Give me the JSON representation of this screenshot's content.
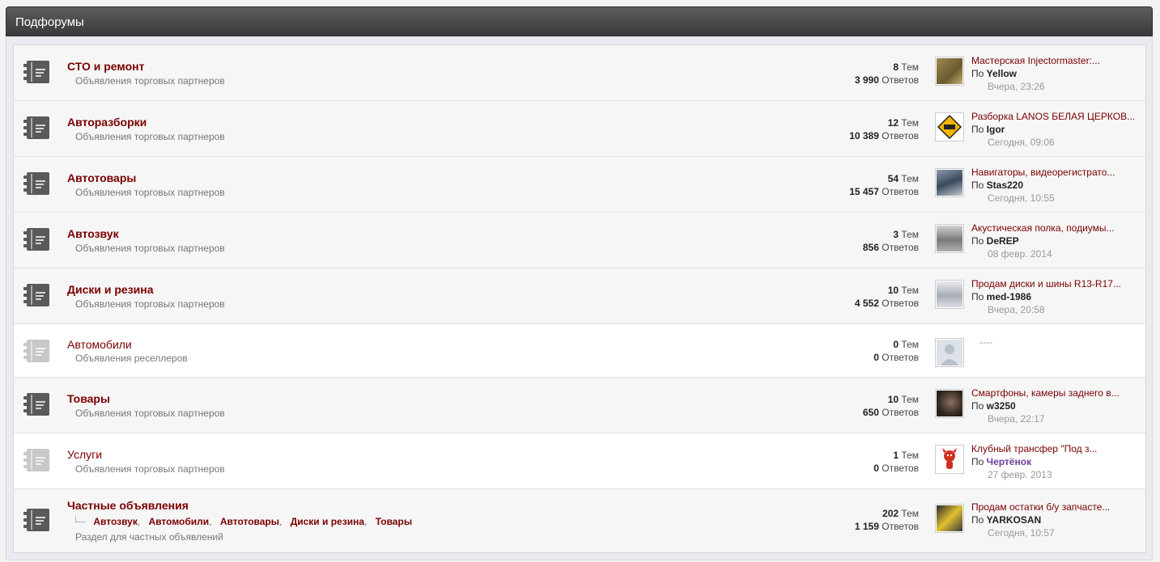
{
  "header": {
    "title": "Подфорумы"
  },
  "labels": {
    "topics": "Тем",
    "replies": "Ответов",
    "by": "По"
  },
  "rows": [
    {
      "title": "СТО и ремонт",
      "desc": "Объявления торговых партнеров",
      "topics": "8",
      "replies": "3 990",
      "last": {
        "title": "Мастерская Injectormaster:...",
        "author": "Yellow",
        "date": "Вчера, 23:26"
      },
      "avatar_color": "#8a7a4a"
    },
    {
      "title": "Авторазборки",
      "desc": "Объявления торговых партнеров",
      "topics": "12",
      "replies": "10 389",
      "last": {
        "title": "Разборка LANOS БЕЛАЯ ЦЕРКОВ...",
        "author": "Igor",
        "date": "Сегодня, 09:06"
      },
      "avatar_color": "#f2b400"
    },
    {
      "title": "Автотовары",
      "desc": "Объявления торговых партнеров",
      "topics": "54",
      "replies": "15 457",
      "last": {
        "title": "Навигаторы, видеорегистрато...",
        "author": "Stas220",
        "date": "Сегодня, 10:55"
      },
      "avatar_color": "#5a6a7a"
    },
    {
      "title": "Автозвук",
      "desc": "Объявления торговых партнеров",
      "topics": "3",
      "replies": "856",
      "last": {
        "title": "Акустическая полка, подиумы...",
        "author": "DeREP",
        "date": "08 февр. 2014"
      },
      "avatar_color": "#9a9a9a"
    },
    {
      "title": "Диски и резина",
      "desc": "Объявления торговых партнеров",
      "topics": "10",
      "replies": "4 552",
      "last": {
        "title": "Продам диски и шины R13-R17...",
        "author": "med-1986",
        "date": "Вчера, 20:58"
      },
      "avatar_color": "#b8bcc4"
    },
    {
      "title": "Автомобили",
      "desc": "Объявления реселлеров",
      "topics": "0",
      "replies": "0",
      "last": {
        "title": "----",
        "author": "",
        "date": ""
      },
      "avatar_color": "#d8dde4",
      "inactive": true
    },
    {
      "title": "Товары",
      "desc": "Объявления торговых партнеров",
      "topics": "10",
      "replies": "650",
      "last": {
        "title": "Смартфоны, камеры заднего в...",
        "author": "w3250",
        "date": "Вчера, 22:17"
      },
      "avatar_color": "#5a4a3a"
    },
    {
      "title": "Услуги",
      "desc": "Объявления торговых партнеров",
      "topics": "1",
      "replies": "0",
      "last": {
        "title": "Клубный трансфер \"Под з...",
        "author": "Чертёнок",
        "date": "27 февр. 2013"
      },
      "avatar_color": "#c0392b",
      "inactive": true
    },
    {
      "title": "Частные объявления",
      "desc": "Раздел для частных объявлений",
      "topics": "202",
      "replies": "1 159",
      "sublinks": [
        "Автозвук",
        "Автомобили",
        "Автотовары",
        "Диски и резина",
        "Товары"
      ],
      "last": {
        "title": "Продам остатки б/у запчасте...",
        "author": "YARKOSAN",
        "date": "Сегодня, 10:57"
      },
      "avatar_color": "#d4b020"
    }
  ]
}
